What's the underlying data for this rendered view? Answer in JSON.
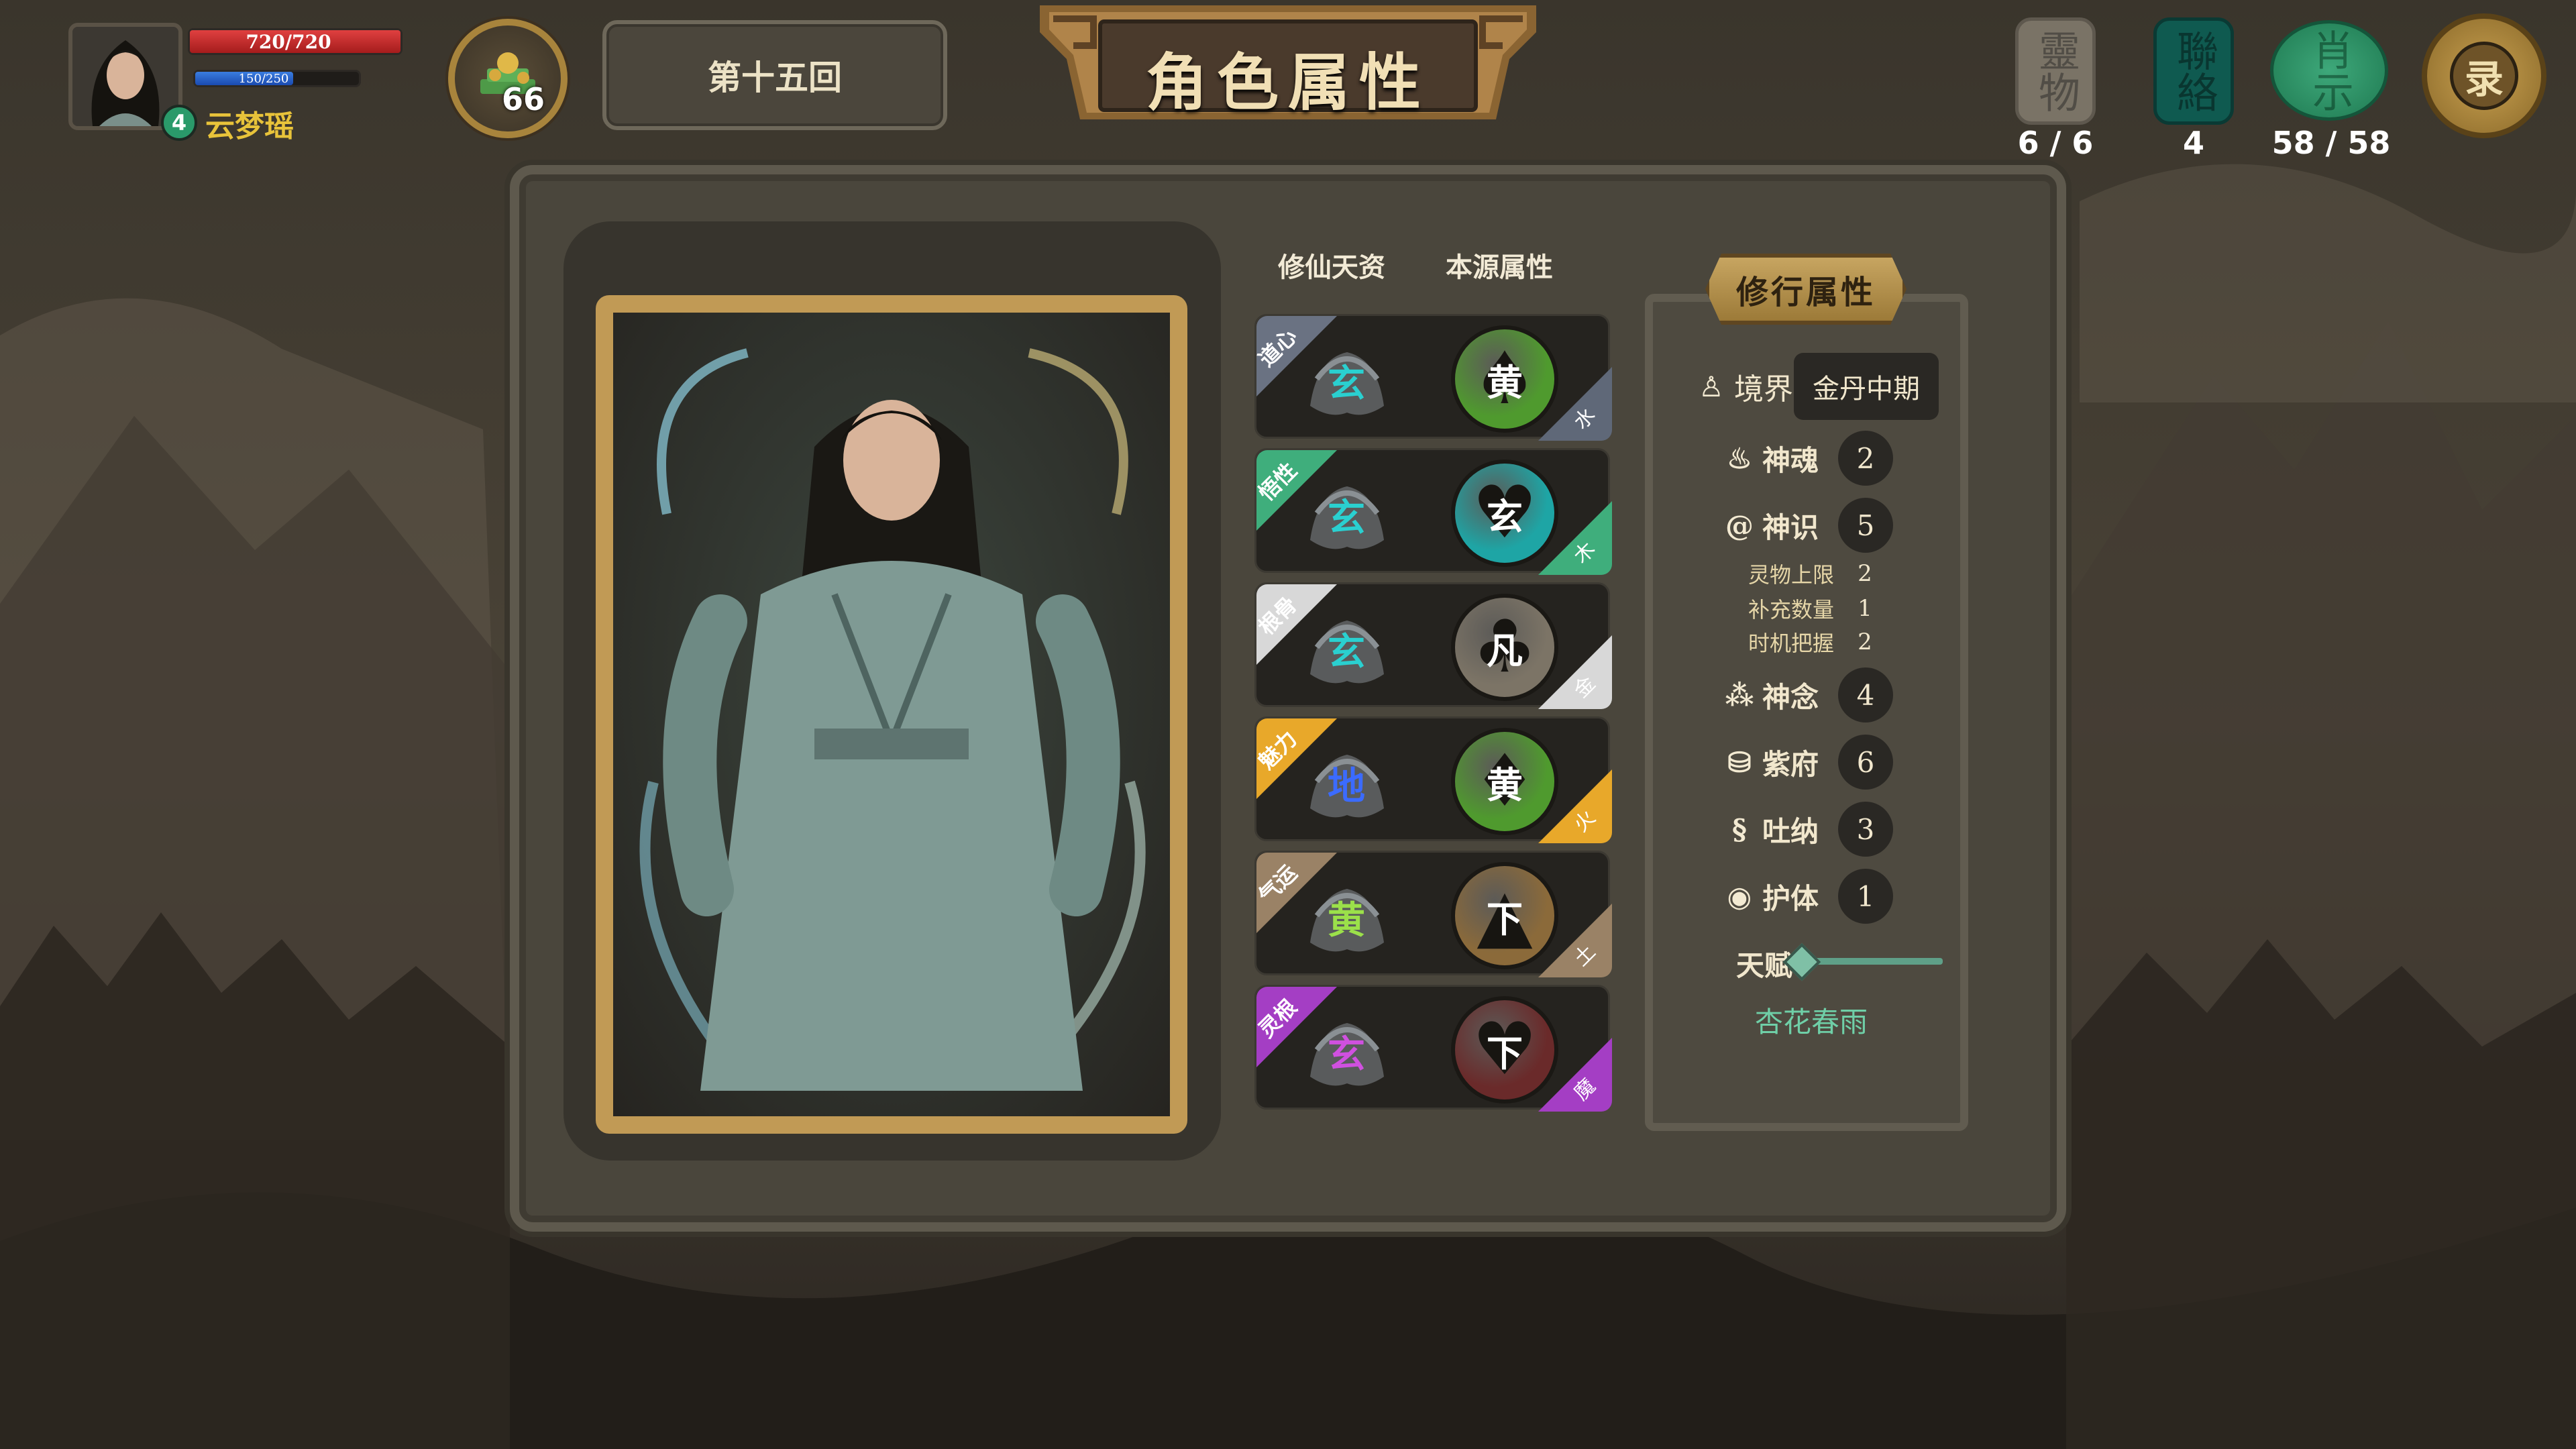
{
  "player": {
    "hp": "720/720",
    "mp": "150/250",
    "level": "4",
    "name": "云梦瑶"
  },
  "coins": "66",
  "round": "第十五回",
  "screen_title": "角色属性",
  "resources": {
    "item1": {
      "glyph": "靈物",
      "value": "6 / 6"
    },
    "item2": {
      "glyph": "聯絡",
      "value": "4"
    },
    "item3": {
      "glyph": "肖示",
      "value": "58 / 58"
    },
    "settings": {
      "glyph": "录",
      "icon": "settings-gear-icon"
    }
  },
  "columns": {
    "talent": "修仙天资",
    "source": "本源属性"
  },
  "aptitudes": [
    {
      "tag": "道心",
      "beast_glyph": "玄",
      "orb_char": "黄",
      "suit": "♠",
      "element": "水",
      "tag_color": "#6a7282",
      "el_color": "#5f6878",
      "orb_color": "#4f9a2e",
      "glyph_color": "#2ad0d0",
      "beast": "tortoise-icon"
    },
    {
      "tag": "悟性",
      "beast_glyph": "玄",
      "orb_char": "玄",
      "suit": "♥",
      "element": "木",
      "tag_color": "#3fae7c",
      "el_color": "#3fae7c",
      "orb_color": "#1ea5a5",
      "glyph_color": "#2ad0d0",
      "beast": "dragon-icon"
    },
    {
      "tag": "根骨",
      "beast_glyph": "玄",
      "orb_char": "凡",
      "suit": "♣",
      "element": "金",
      "tag_color": "#d8d8d8",
      "el_color": "#d8d8d8",
      "orb_color": "#7c7466",
      "glyph_color": "#2ad0d0",
      "beast": "tiger-icon"
    },
    {
      "tag": "魅力",
      "beast_glyph": "地",
      "orb_char": "黄",
      "suit": "♦",
      "element": "火",
      "tag_color": "#e8a82a",
      "el_color": "#e8a82a",
      "orb_color": "#4f9a2e",
      "glyph_color": "#3b6bff",
      "beast": "phoenix-icon"
    },
    {
      "tag": "气运",
      "beast_glyph": "黄",
      "orb_char": "下",
      "suit": "▲",
      "element": "土",
      "tag_color": "#9a8266",
      "el_color": "#9a8266",
      "orb_color": "#8b6a3a",
      "glyph_color": "#9be04a",
      "beast": "qilin-icon"
    },
    {
      "tag": "灵根",
      "beast_glyph": "玄",
      "orb_char": "下",
      "suit": "♥",
      "element": "魔",
      "tag_color": "#a43ec4",
      "el_color": "#a43ec4",
      "orb_color": "#6a2a2a",
      "glyph_color": "#d050e0",
      "beast": "demon-bird-icon"
    }
  ],
  "cultivation": {
    "title": "修行属性",
    "realm_label": "境界",
    "realm_value": "金丹中期",
    "stats": [
      {
        "label": "神魂",
        "value": "2",
        "icon": "flame-icon",
        "glyph": "♨"
      },
      {
        "label": "神识",
        "value": "5",
        "icon": "swirl-icon",
        "glyph": "@"
      }
    ],
    "substats": [
      {
        "label": "灵物上限",
        "value": "2"
      },
      {
        "label": "补充数量",
        "value": "1"
      },
      {
        "label": "时机把握",
        "value": "2"
      }
    ],
    "stats2": [
      {
        "label": "神念",
        "value": "4",
        "icon": "triangle-dots-icon",
        "glyph": "⁂"
      },
      {
        "label": "紫府",
        "value": "6",
        "icon": "cauldron-icon",
        "glyph": "⛁"
      },
      {
        "label": "吐纳",
        "value": "3",
        "icon": "knot-icon",
        "glyph": "§"
      },
      {
        "label": "护体",
        "value": "1",
        "icon": "shield-icon",
        "glyph": "◉"
      }
    ],
    "talent_label": "天赋",
    "talent_value": "杏花春雨"
  },
  "colors": {
    "hp": "#c82a2a",
    "mp": "#2a5fd0",
    "accent_gold": "#c19a55",
    "talent_green": "#6fcfa7"
  },
  "levels": {
    "hp_fill": 1.0,
    "mp_fill": 0.6
  }
}
